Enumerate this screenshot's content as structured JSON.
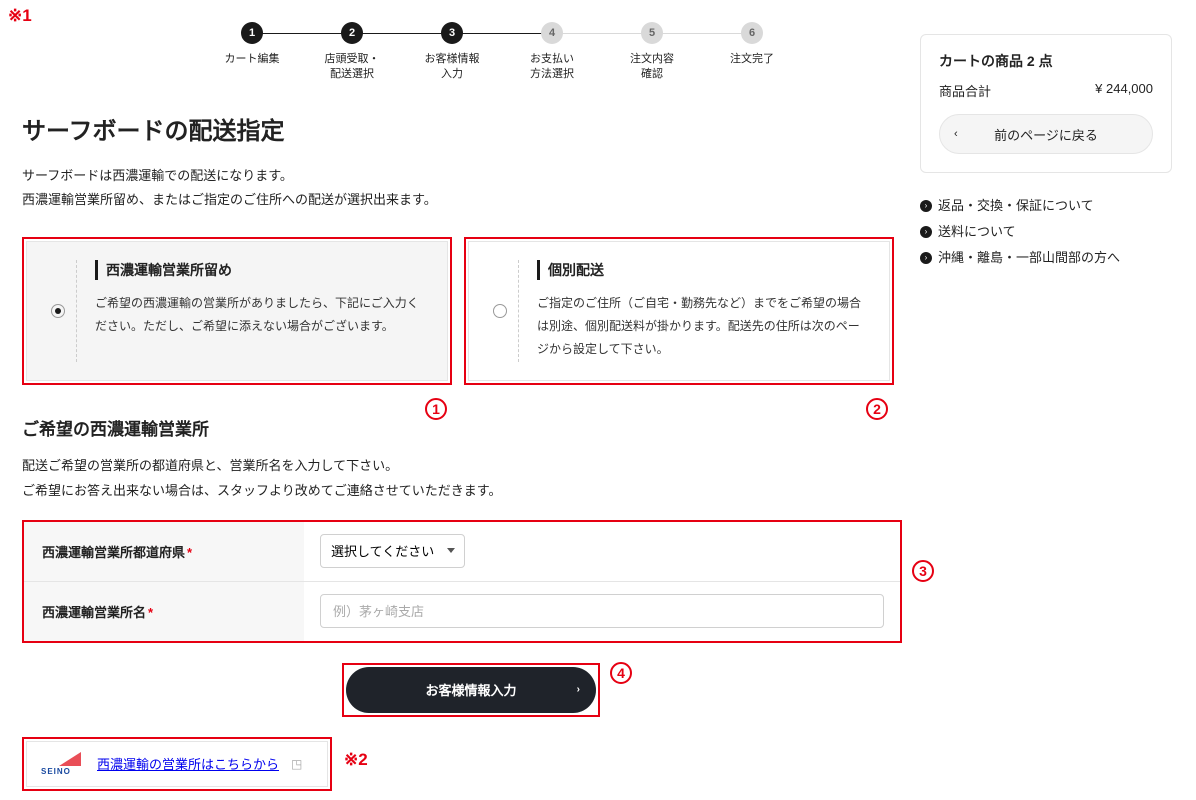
{
  "annotations": {
    "note1": "※1",
    "note2": "※2",
    "c1": "1",
    "c2": "2",
    "c3": "3",
    "c4": "4"
  },
  "steps": [
    {
      "num": "1",
      "label": "カート編集",
      "done": true
    },
    {
      "num": "2",
      "label": "店頭受取・\n配送選択",
      "done": true
    },
    {
      "num": "3",
      "label": "お客様情報\n入力",
      "done": true
    },
    {
      "num": "4",
      "label": "お支払い\n方法選択",
      "done": false
    },
    {
      "num": "5",
      "label": "注文内容\n確認",
      "done": false
    },
    {
      "num": "6",
      "label": "注文完了",
      "done": false
    }
  ],
  "heading": "サーフボードの配送指定",
  "lead1": "サーフボードは西濃運輸での配送になります。",
  "lead2": "西濃運輸営業所留め、またはご指定のご住所への配送が選択出来ます。",
  "options": [
    {
      "title": "西濃運輸営業所留め",
      "desc": "ご希望の西濃運輸の営業所がありましたら、下記にご入力ください。ただし、ご希望に添えない場合がございます。",
      "selected": true
    },
    {
      "title": "個別配送",
      "desc": "ご指定のご住所（ご自宅・勤務先など）までをご希望の場合は別途、個別配送料が掛かります。配送先の住所は次のページから設定して下さい。",
      "selected": false
    }
  ],
  "sub_heading": "ご希望の西濃運輸営業所",
  "sublead1": "配送ご希望の営業所の都道府県と、営業所名を入力して下さい。",
  "sublead2": "ご希望にお答え出来ない場合は、スタッフより改めてご連絡させていただきます。",
  "form": {
    "pref_label": "西濃運輸営業所都道府県",
    "pref_placeholder": "選択してください",
    "name_label": "西濃運輸営業所名",
    "name_placeholder": "例）茅ヶ崎支店",
    "required": "*"
  },
  "submit_label": "お客様情報入力",
  "seino_text": "SEINO",
  "ext_link": "西濃運輸の営業所はこちらから",
  "cart": {
    "title": "カートの商品 2 点",
    "row_label": "商品合計",
    "row_value": "¥ 244,000",
    "back": "前のページに戻る"
  },
  "links": [
    "返品・交換・保証について",
    "送料について",
    "沖縄・離島・一部山間部の方へ"
  ]
}
